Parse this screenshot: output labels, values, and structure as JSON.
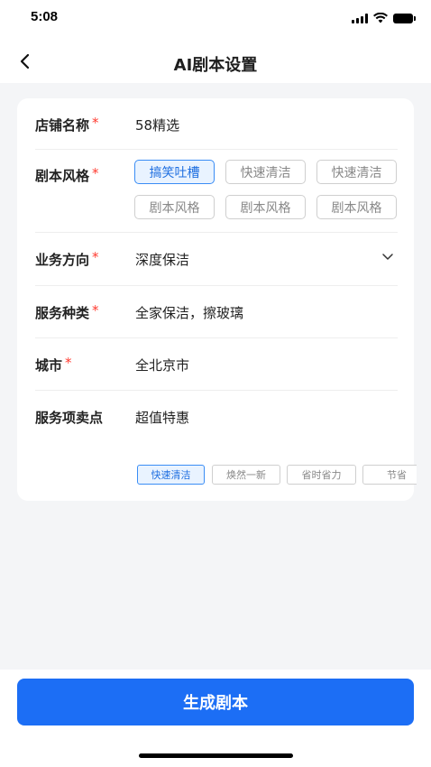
{
  "status_bar": {
    "time": "5:08"
  },
  "nav": {
    "title": "AI剧本设置"
  },
  "form": {
    "shop_name": {
      "label": "店铺名称",
      "required_mark": "*",
      "value": "58精选"
    },
    "script_style": {
      "label": "剧本风格",
      "required_mark": "*",
      "options": [
        "搞笑吐槽",
        "快速清洁",
        "快速清洁",
        "剧本风格",
        "剧本风格",
        "剧本风格"
      ],
      "selected_index": 0
    },
    "business_direction": {
      "label": "业务方向",
      "required_mark": "*",
      "value": "深度保洁"
    },
    "service_type": {
      "label": "服务种类",
      "required_mark": "*",
      "value": "全家保洁，擦玻璃"
    },
    "city": {
      "label": "城市",
      "required_mark": "*",
      "value": "全北京市"
    },
    "selling_point": {
      "label": "服务项卖点",
      "value": "超值特惠",
      "tags": [
        "快速清洁",
        "焕然一新",
        "省时省力",
        "节省"
      ],
      "selected_tag_index": 0
    }
  },
  "footer": {
    "generate_button": "生成剧本"
  },
  "colors": {
    "accent": "#1c6ef5",
    "required": "#ff3b30",
    "chip_active_bg": "#e9f3ff"
  }
}
